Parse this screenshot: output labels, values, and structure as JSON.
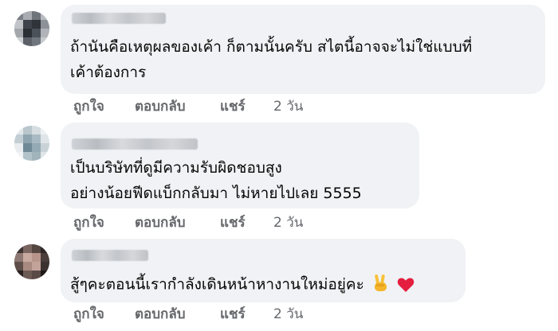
{
  "comments": [
    {
      "lines": [
        "ถ้านันคือเหตุผลของเค้า ก็ตามนั้นครับ สไตนี้อาจจะไม่ใช่แบบที่",
        "เค้าต้องการ"
      ],
      "actions": {
        "like": "ถูกใจ",
        "reply": "ตอบกลับ",
        "share": "แชร์",
        "time": "2 วัน"
      }
    },
    {
      "lines": [
        "เป็นบริษัทที่ดูมีความรับผิดชอบสูง",
        "อย่างน้อยฟีดแบ็กกลับมา ไม่หายไปเลย 5555"
      ],
      "actions": {
        "like": "ถูกใจ",
        "reply": "ตอบกลับ",
        "share": "แชร์",
        "time": "2 วัน"
      }
    },
    {
      "lines": [
        "สู้ๆคะตอนนี้เรากำลังเดินหน้าหางานใหม่อยู่คะ"
      ],
      "emoji": [
        "victory-hand",
        "red-heart"
      ],
      "actions": {
        "like": "ถูกใจ",
        "reply": "ตอบกลับ",
        "share": "แชร์",
        "time": "2 วัน"
      }
    }
  ],
  "colors": {
    "bubble": "#f0f2f5",
    "text": "#050505",
    "meta": "#65676b",
    "heart": "#e41e3f",
    "hand": "#f7c23b"
  }
}
